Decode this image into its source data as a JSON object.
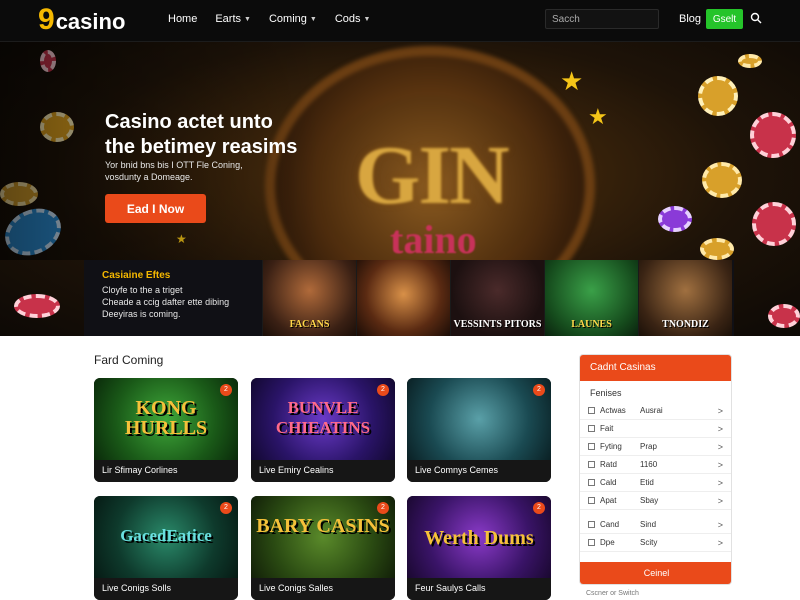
{
  "header": {
    "logo_nine": "9",
    "logo_word": "casino",
    "nav": [
      {
        "label": "Home",
        "caret": false
      },
      {
        "label": "Earts",
        "caret": true
      },
      {
        "label": "Coming",
        "caret": true
      },
      {
        "label": "Cods",
        "caret": true
      }
    ],
    "search_placeholder": "Sacch",
    "blog": "Blog",
    "cta": "Gselt",
    "search_icon": "search-icon"
  },
  "hero": {
    "title": "Casino actet unto the betimey reasims",
    "subtitle": "Yor bnid bns bis I OTT Fle Coning, vosdunty a Domeage.",
    "cta": "Ead I Now",
    "big_text": "GIN",
    "big_casino": "taino"
  },
  "strip": {
    "title": "Casiaine Eftes",
    "lines": [
      "Cloyfe to the a triget",
      "Cheade a ccig dafter ette dibing",
      "Deeyiras is coming."
    ],
    "tiles": [
      {
        "label": "FACANS"
      },
      {
        "label": ""
      },
      {
        "label": "VESSINTS PITORS"
      },
      {
        "label": "LAUNES"
      },
      {
        "label": "TNONDIZ"
      }
    ]
  },
  "main": {
    "section_title": "Fard Coming",
    "cards": [
      {
        "art": "KONG HURLLS",
        "caption": "Lir Sfimay Corlines",
        "badge": "2"
      },
      {
        "art": "BUNVLE CHIEATINS",
        "caption": "Live Emiry Cealins",
        "badge": "2"
      },
      {
        "art": "",
        "caption": "Live Comnys Cemes",
        "badge": "2"
      },
      {
        "art": "GacedEatice",
        "caption": "Live Conigs Solls",
        "badge": "2"
      },
      {
        "art": "BARY CASINS",
        "caption": "Live Conigs Salles",
        "badge": "2"
      },
      {
        "art": "Werth Dums",
        "caption": "Feur Saulys Calls",
        "badge": "2"
      }
    ]
  },
  "panel": {
    "title": "Cadnt Casinas",
    "filter_label": "Fenises",
    "rows": [
      {
        "a": "Actwas",
        "b": "Ausrai",
        "chev": ">"
      },
      {
        "a": "Fait",
        "b": "",
        "chev": ">"
      },
      {
        "a": "Fyting",
        "b": "Prap",
        "chev": ">"
      },
      {
        "a": "Ratd",
        "b": "1160",
        "chev": ">"
      },
      {
        "a": "Cald",
        "b": "Etid",
        "chev": ">"
      },
      {
        "a": "Apat",
        "b": "Sbay",
        "chev": ">"
      },
      {
        "a": "Cand",
        "b": "Sind",
        "chev": ">"
      },
      {
        "a": "Dpe",
        "b": "Scity",
        "chev": ">"
      }
    ],
    "button": "Ceinel",
    "footer": "Cscner or Switch"
  },
  "colors": {
    "accent_orange": "#ea4a1a",
    "accent_green": "#25c42a",
    "logo_gold": "#f5b800"
  }
}
